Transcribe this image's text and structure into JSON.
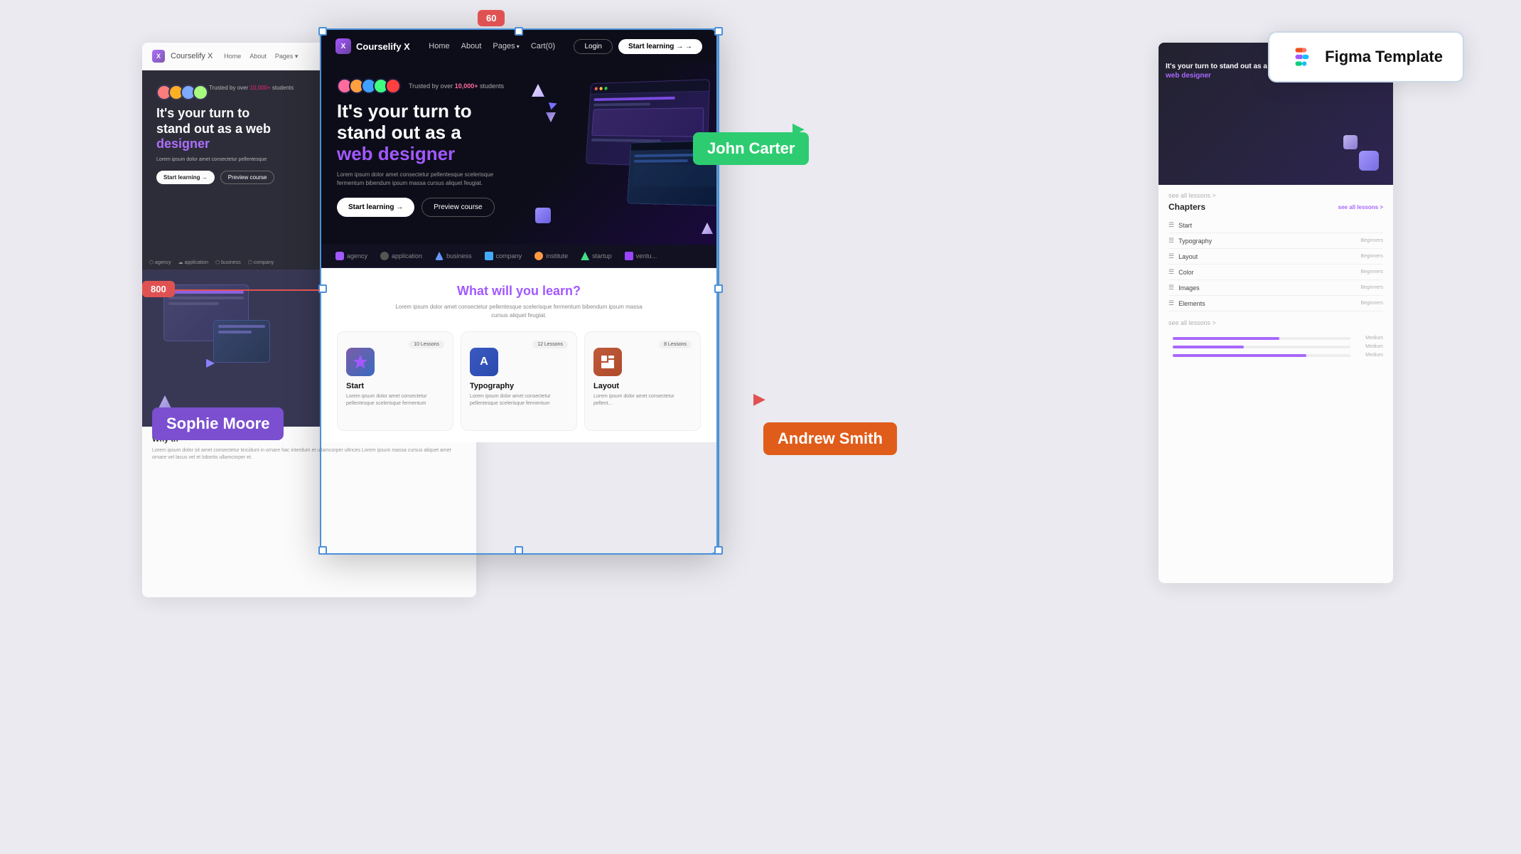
{
  "canvas": {
    "background": "#eaeaf0"
  },
  "width_badge": {
    "value": "60"
  },
  "height_badge": {
    "value": "800"
  },
  "figma_badge": {
    "icon_label": "Figma",
    "text": "Figma Template"
  },
  "user_badges": {
    "sophie": "Sophie Moore",
    "john": "John Carter",
    "andrew": "Andrew Smith"
  },
  "main_frame": {
    "navbar": {
      "logo_text": "Courselify X",
      "nav_items": [
        "Home",
        "About",
        "Pages",
        "Cart(0)"
      ],
      "btn_login": "Login",
      "btn_start": "Start learning →"
    },
    "hero": {
      "trusted_text": "Trusted by over",
      "trusted_count": "10,000+",
      "trusted_suffix": "students",
      "title_line1": "It's your turn to",
      "title_line2": "stand out as a",
      "title_accent": "web designer",
      "description": "Lorem ipsum dolor amet consectetur pellentesque scelerisque fermentum bibendum ipsum massa cursus aliquet feugiat.",
      "btn_start": "Start learning →",
      "btn_preview": "Preview course"
    },
    "tags": [
      "agency",
      "application",
      "business",
      "company",
      "institute",
      "startup",
      "venture"
    ],
    "learn_section": {
      "title": "What will ",
      "title_accent": "you learn?",
      "subtitle": "Lorem ipsum dolor amet consectetur pellentesque scelerisque fermentum bibendum ipsum massa cursus aliquet feugiat.",
      "cards": [
        {
          "title": "Start",
          "lessons": "10 Lessons",
          "description": "Lorem ipsum dolor amet consectetur pellentesque scelerisque fermentum"
        },
        {
          "title": "Typography",
          "lessons": "12 Lessons",
          "description": "Lorem ipsum dolor amet consectetur pellentesque scelerisque fermentum"
        },
        {
          "title": "Layout",
          "lessons": "8 Lessons",
          "description": "Lorem ipsum dolor amet consectetur pellentesque scelerisque ferment..."
        }
      ]
    }
  },
  "left_preview": {
    "logo": "Courselify X",
    "hero_title_1": "It's your turn to",
    "hero_title_2": "stand out as a web",
    "hero_title_3": "designer",
    "why_title": "Why th",
    "why_desc": "Lorem ipsum dolor sit amet consectetur tincidunt in ornare hac interdum et ullamcorper ultrices Lorem ipsum massa cursus aliquet amet ornare vel lacus vel et lobortis ullamcorper et."
  },
  "right_panel": {
    "chapters_title": "Chapters",
    "see_all": "see all lessons >",
    "chapters": [
      {
        "name": "Start",
        "level": ""
      },
      {
        "name": "Typography",
        "badge": "",
        "level": "Beginners"
      },
      {
        "name": "Layout",
        "badge": "",
        "level": "Beginners"
      },
      {
        "name": "Color",
        "badge": "",
        "level": "Beginners"
      },
      {
        "name": "Images",
        "badge": "",
        "level": "Beginners"
      },
      {
        "name": "Elements",
        "badge": "",
        "level": "Beginners"
      }
    ],
    "progress_items": [
      {
        "label": "",
        "level": "Medium"
      },
      {
        "label": "",
        "level": "Medium"
      },
      {
        "label": "",
        "level": "Medium"
      }
    ]
  }
}
